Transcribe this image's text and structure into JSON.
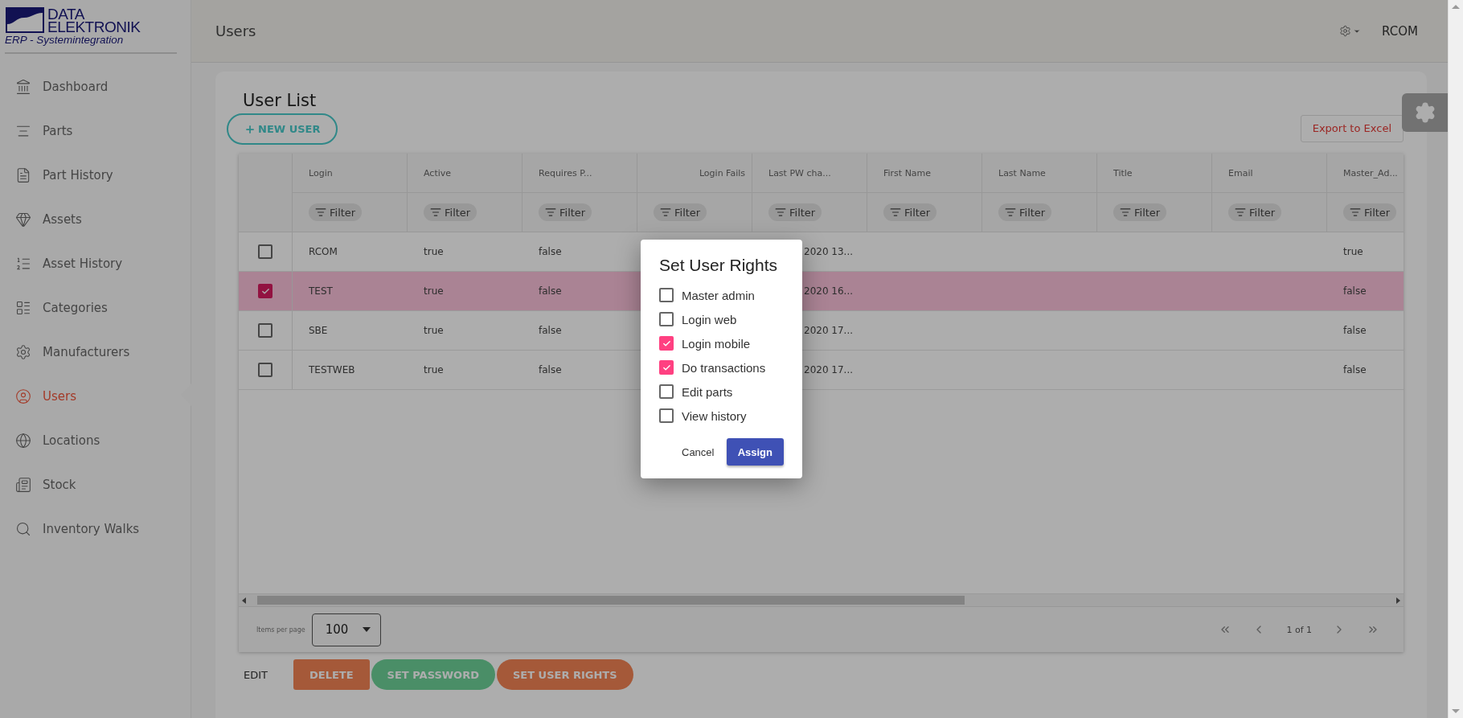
{
  "logo": {
    "line_1": "DATA",
    "line_2": "ELEKTRONIK",
    "tagline": "ERP - Systemintegration"
  },
  "sidebar": {
    "items": [
      {
        "label": "Dashboard",
        "selected": false
      },
      {
        "label": "Parts",
        "selected": false
      },
      {
        "label": "Part History",
        "selected": false
      },
      {
        "label": "Assets",
        "selected": false
      },
      {
        "label": "Asset History",
        "selected": false
      },
      {
        "label": "Categories",
        "selected": false
      },
      {
        "label": "Manufacturers",
        "selected": false
      },
      {
        "label": "Users",
        "selected": true
      },
      {
        "label": "Locations",
        "selected": false
      },
      {
        "label": "Stock",
        "selected": false
      },
      {
        "label": "Inventory Walks",
        "selected": false
      }
    ]
  },
  "header": {
    "title": "Users",
    "user": "RCOM"
  },
  "user_list": {
    "title": "User List",
    "new_user_button": "NEW USER",
    "export_button": "Export to Excel"
  },
  "table": {
    "columns": [
      {
        "label": "Login",
        "kind": "text",
        "filter": "Filter"
      },
      {
        "label": "Active",
        "kind": "text",
        "filter": "Filter"
      },
      {
        "label": "Requires P...",
        "kind": "text",
        "filter": "Filter"
      },
      {
        "label": "Login Fails",
        "kind": "number",
        "filter": "Filter"
      },
      {
        "label": "Last PW cha...",
        "kind": "text",
        "filter": "Filter"
      },
      {
        "label": "First Name",
        "kind": "text",
        "filter": "Filter"
      },
      {
        "label": "Last Name",
        "kind": "text",
        "filter": "Filter"
      },
      {
        "label": "Title",
        "kind": "text",
        "filter": "Filter"
      },
      {
        "label": "Email",
        "kind": "text",
        "filter": "Filter"
      },
      {
        "label": "Master_Ad...",
        "kind": "text",
        "filter": "Filter"
      }
    ],
    "rows": [
      {
        "selected": false,
        "login": "RCOM",
        "active": "true",
        "requires_p": "false",
        "last_pw_change": "2020 13...",
        "master_admin": "true"
      },
      {
        "selected": true,
        "login": "TEST",
        "active": "true",
        "requires_p": "false",
        "last_pw_change": "2020 16...",
        "master_admin": "false"
      },
      {
        "selected": false,
        "login": "SBE",
        "active": "true",
        "requires_p": "false",
        "last_pw_change": "2020 17...",
        "master_admin": "false"
      },
      {
        "selected": false,
        "login": "TESTWEB",
        "active": "true",
        "requires_p": "false",
        "last_pw_change": "2020 17...",
        "master_admin": "false"
      }
    ]
  },
  "footer": {
    "items_per_page_label": "Items per page",
    "page_size": "100",
    "page_info": "1 of 1"
  },
  "actions": [
    {
      "label": "EDIT",
      "kind": "text"
    },
    {
      "label": "DELETE",
      "kind": "danger"
    },
    {
      "label": "SET PASSWORD",
      "kind": "success"
    },
    {
      "label": "SET USER RIGHTS",
      "kind": "warning"
    }
  ],
  "dialog": {
    "title": "Set User Rights",
    "options": [
      {
        "label": "Master admin",
        "checked": false
      },
      {
        "label": "Login web",
        "checked": false
      },
      {
        "label": "Login mobile",
        "checked": true
      },
      {
        "label": "Do transactions",
        "checked": true
      },
      {
        "label": "Edit parts",
        "checked": false
      },
      {
        "label": "View history",
        "checked": false
      }
    ],
    "buttons": [
      {
        "label": "Cancel",
        "kind": "text"
      },
      {
        "label": "Assign",
        "kind": "primary"
      }
    ]
  }
}
